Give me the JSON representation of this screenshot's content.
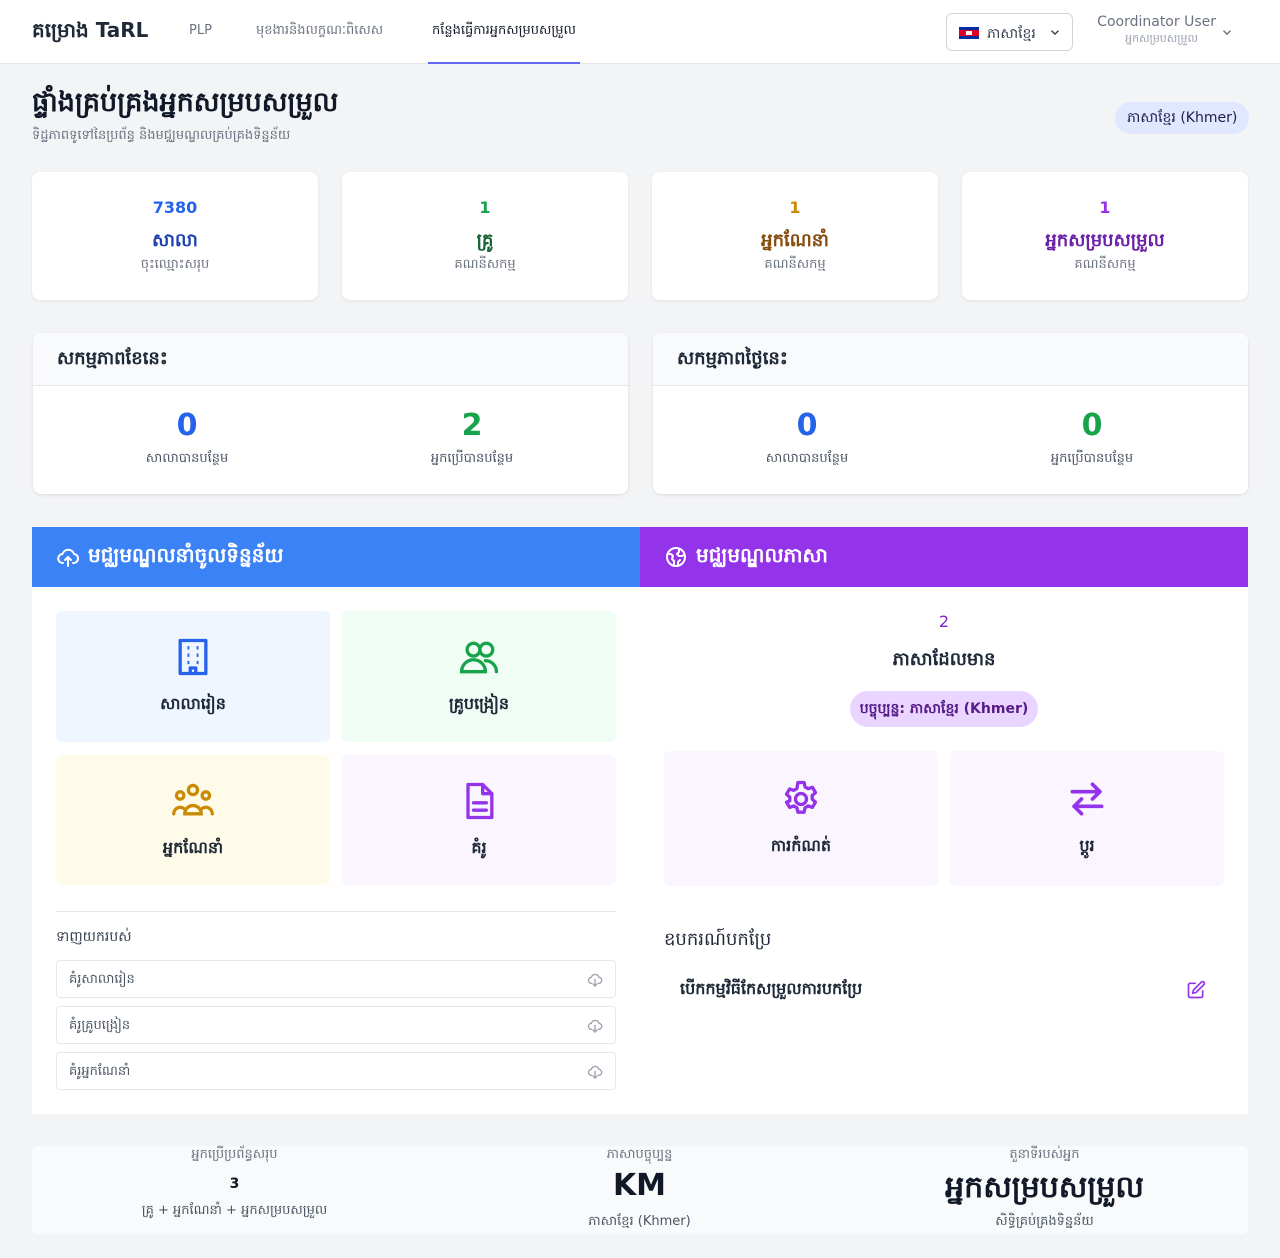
{
  "nav": {
    "brand": "គម្រោង TaRL",
    "items": [
      {
        "label": "PLP"
      },
      {
        "label": "មុខងារនិងលក្ខណៈពិសេស"
      },
      {
        "label": "កន្លែងធ្វើការអ្នកសម្របសម្រួល"
      }
    ],
    "active_index": 2,
    "language_label": "ភាសាខ្មែរ",
    "user_name": "Coordinator User",
    "user_role": "អ្នកសម្របសម្រួល"
  },
  "header": {
    "title": "ផ្ទាំងគ្រប់គ្រងអ្នកសម្របសម្រួល",
    "subtitle": "ទិដ្ឋភាពទូទៅនៃប្រព័ន្ធ និងមជ្ឈមណ្ឌលគ្រប់គ្រងទិន្នន័យ",
    "language_badge": "ភាសាខ្មែរ (Khmer)"
  },
  "stats": [
    {
      "value": "7380",
      "label": "សាលា",
      "sub": "ចុះឈ្មោះសរុប",
      "color": "#2563eb",
      "label_color": "#1e40af"
    },
    {
      "value": "1",
      "label": "គ្រូ",
      "sub": "គណនីសកម្ម",
      "color": "#16a34a",
      "label_color": "#166534"
    },
    {
      "value": "1",
      "label": "អ្នកណែនាំ",
      "sub": "គណនីសកម្ម",
      "color": "#ca8a04",
      "label_color": "#854d0e"
    },
    {
      "value": "1",
      "label": "អ្នកសម្របសម្រួល",
      "sub": "គណនីសកម្ម",
      "color": "#9333ea",
      "label_color": "#6b21a8"
    }
  ],
  "activity_month": {
    "title": "សកម្មភាពខែនេះ",
    "schools_added": "0",
    "schools_added_label": "សាលាបានបន្ថែម",
    "users_added": "2",
    "users_added_label": "អ្នកប្រើបានបន្ថែម"
  },
  "activity_today": {
    "title": "សកម្មភាពថ្ងៃនេះ",
    "schools_added": "0",
    "schools_added_label": "សាលាបានបន្ថែម",
    "users_added": "0",
    "users_added_label": "អ្នកប្រើបានបន្ថែម"
  },
  "import_hub": {
    "title": "មជ្ឈមណ្ឌលនាំចូលទិន្នន័យ",
    "header_color": "#3b82f6",
    "tiles": [
      {
        "label": "សាលារៀន",
        "icon": "building-icon",
        "bg": "#eff6ff",
        "icon_color": "#2563eb"
      },
      {
        "label": "គ្រូបង្រៀន",
        "icon": "users-icon",
        "bg": "#f0fdf4",
        "icon_color": "#16a34a"
      },
      {
        "label": "អ្នកណែនាំ",
        "icon": "user-group-icon",
        "bg": "#fefce8",
        "icon_color": "#ca8a04"
      },
      {
        "label": "គំរូ",
        "icon": "document-icon",
        "bg": "#faf5ff",
        "icon_color": "#9333ea"
      }
    ],
    "templates_heading": "ទាញយករបស់",
    "templates": [
      {
        "label": "គំរូសាលារៀន"
      },
      {
        "label": "គំរូគ្រូបង្រៀន"
      },
      {
        "label": "គំរូអ្នកណែនាំ"
      }
    ]
  },
  "language_hub": {
    "title": "មជ្ឈមណ្ឌលភាសា",
    "header_color": "#9333ea",
    "available_count": "2",
    "available_label": "ភាសាដែលមាន",
    "current_label": "បច្ចុប្បន្ន: ភាសាខ្មែរ (Khmer)",
    "tiles": [
      {
        "label": "ការកំណត់",
        "icon": "gear-icon"
      },
      {
        "label": "ប្តូរ",
        "icon": "switch-arrows-icon"
      }
    ],
    "tools_heading": "ឧបករណ៍បកប្រែ",
    "tools_link": "បើកកម្មវិធីកែសម្រួលការបកប្រែ"
  },
  "summary": {
    "total_users_label": "អ្នកប្រើប្រព័ន្ធសរុប",
    "total_users_value": "3",
    "total_users_desc": "គ្រូ + អ្នកណែនាំ + អ្នកសម្របសម្រួល",
    "current_language_label": "ភាសាបច្ចុប្បន្ន",
    "current_language_code": "KM",
    "current_language_desc": "ភាសាខ្មែរ (Khmer)",
    "role_label": "តួនាទីរបស់អ្នក",
    "role_value": "អ្នកសម្របសម្រួល",
    "role_desc": "សិទ្ធិគ្រប់គ្រងទិន្នន័យ"
  }
}
